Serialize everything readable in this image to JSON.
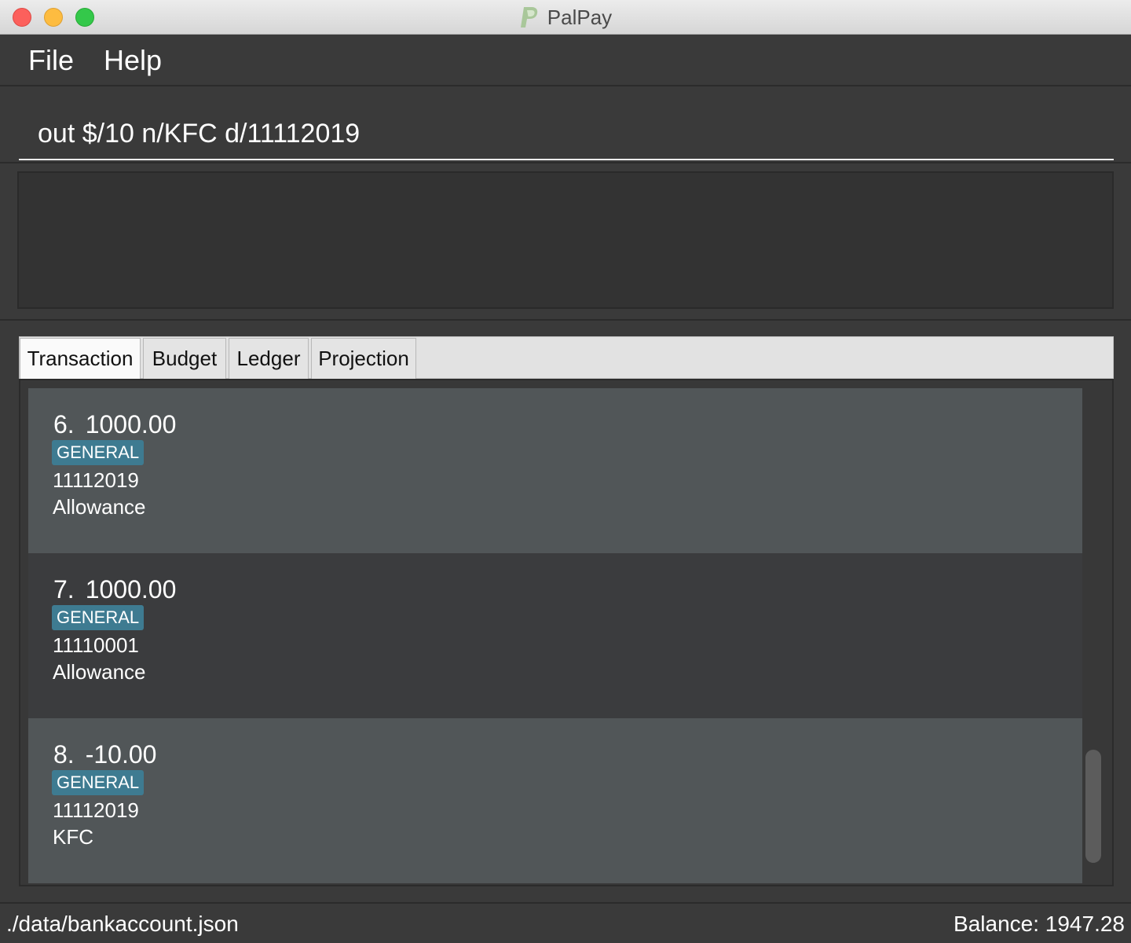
{
  "window": {
    "title": "PalPay",
    "logo_icon": "paypal-p-icon"
  },
  "menu": {
    "file": "File",
    "help": "Help"
  },
  "command": {
    "value": "out $/10 n/KFC d/11112019",
    "placeholder": ""
  },
  "result": {
    "text": ""
  },
  "tabs": [
    {
      "label": "Transaction",
      "active": true
    },
    {
      "label": "Budget",
      "active": false
    },
    {
      "label": "Ledger",
      "active": false
    },
    {
      "label": "Projection",
      "active": false
    }
  ],
  "transactions": [
    {
      "index": "6.",
      "amount": "1000.00",
      "tag": "GENERAL",
      "date": "11112019",
      "description": "Allowance"
    },
    {
      "index": "7.",
      "amount": "1000.00",
      "tag": "GENERAL",
      "date": "11110001",
      "description": "Allowance"
    },
    {
      "index": "8.",
      "amount": "-10.00",
      "tag": "GENERAL",
      "date": "11112019",
      "description": "KFC"
    }
  ],
  "status": {
    "file_path": "./data/bankaccount.json",
    "balance": "Balance: 1947.28"
  },
  "colors": {
    "tag_bg": "#3e7b91",
    "card_light": "#515658",
    "card_dark": "#3b3c3e",
    "panel_bg": "#3a3a3a"
  }
}
